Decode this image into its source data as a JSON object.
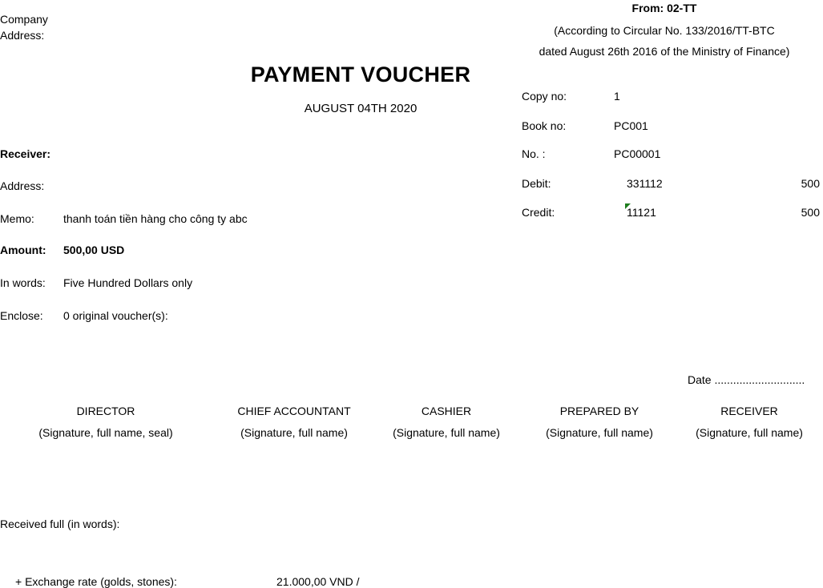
{
  "header": {
    "company_label": "Company",
    "address_label": "Address:",
    "form_code": "From: 02-TT",
    "circular_line1": "(According to Circular No. 133/2016/TT-BTC",
    "circular_line2": "dated August 26th 2016 of the Ministry of Finance)"
  },
  "voucher": {
    "title": "PAYMENT VOUCHER",
    "date": "AUGUST 04TH 2020"
  },
  "info": {
    "copy_label": "Copy no:",
    "copy_value": "1",
    "book_label": "Book no:",
    "book_value": "PC001",
    "no_label": "No. :",
    "no_value": "PC00001",
    "debit_label": "Debit:",
    "debit_account": "331112",
    "debit_amount": "500",
    "credit_label": "Credit:",
    "credit_account": "11121",
    "credit_amount": "500"
  },
  "fields": {
    "receiver_label": "Receiver:",
    "address_label": "Address:",
    "memo_label": "Memo:",
    "memo_value": "thanh toán tiền hàng cho công ty abc",
    "amount_label": "Amount:",
    "amount_value": "500,00 USD",
    "inwords_label": "In words:",
    "inwords_value": "Five Hundred Dollars only",
    "enclose_label": "Enclose:",
    "enclose_value": "0 original voucher(s):"
  },
  "date_line": "Date .............................",
  "signatures": [
    {
      "role": "DIRECTOR",
      "note": "(Signature, full name, seal)"
    },
    {
      "role": "CHIEF ACCOUNTANT",
      "note": "(Signature, full name)"
    },
    {
      "role": "CASHIER",
      "note": "(Signature, full name)"
    },
    {
      "role": "PREPARED BY",
      "note": "(Signature, full name)"
    },
    {
      "role": "RECEIVER",
      "note": "(Signature, full name)"
    }
  ],
  "footer": {
    "received_label": "Received full (in words):",
    "exchange_label": "+ Exchange rate (golds, stones):",
    "exchange_value": "21.000,00 VND /"
  }
}
